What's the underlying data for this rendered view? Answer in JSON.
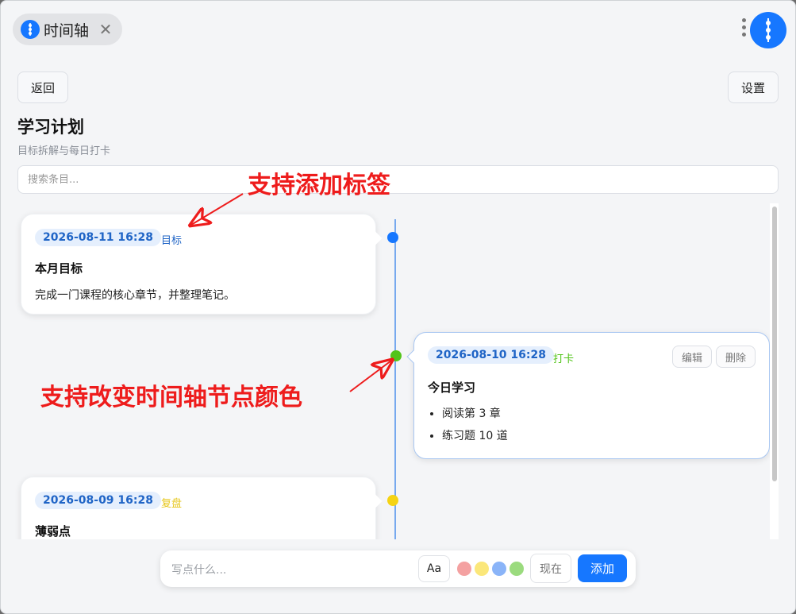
{
  "tab": {
    "label": "时间轴",
    "close_glyph": "✕",
    "icon": "timeline-icon"
  },
  "header": {
    "back_label": "返回",
    "settings_label": "设置",
    "title": "学习计划",
    "subtitle": "目标拆解与每日打卡"
  },
  "search": {
    "placeholder": "搜索条目..."
  },
  "timeline": {
    "axis_color": "#77a9ee",
    "entries": [
      {
        "date": "2026-08-11 16:28",
        "tag": "目标",
        "tag_color": "#1f64c6",
        "title": "本月目标",
        "body": "完成一门课程的核心章节，并整理笔记。",
        "node_color": "#1677ff",
        "side": "left"
      },
      {
        "date": "2026-08-10 16:28",
        "tag": "打卡",
        "tag_color": "#52c41a",
        "title": "今日学习",
        "list": [
          "阅读第 3 章",
          "练习题 10 道"
        ],
        "node_color": "#52c41a",
        "side": "right",
        "edit_label": "编辑",
        "delete_label": "删除"
      },
      {
        "date": "2026-08-09 16:28",
        "tag": "复盘",
        "tag_color": "#e6c619",
        "title": "薄弱点",
        "node_color": "#f5d313",
        "side": "left"
      }
    ]
  },
  "annotations": {
    "tags": "支持添加标签",
    "node_color": "支持改变时间轴节点颜色",
    "color": "#ee1c1c"
  },
  "composer": {
    "placeholder": "写点什么...",
    "font_label": "Aa",
    "swatches": [
      "#f4a1a1",
      "#fbe77a",
      "#8ab4f8",
      "#9bdb7e"
    ],
    "now_label": "现在",
    "add_label": "添加"
  }
}
